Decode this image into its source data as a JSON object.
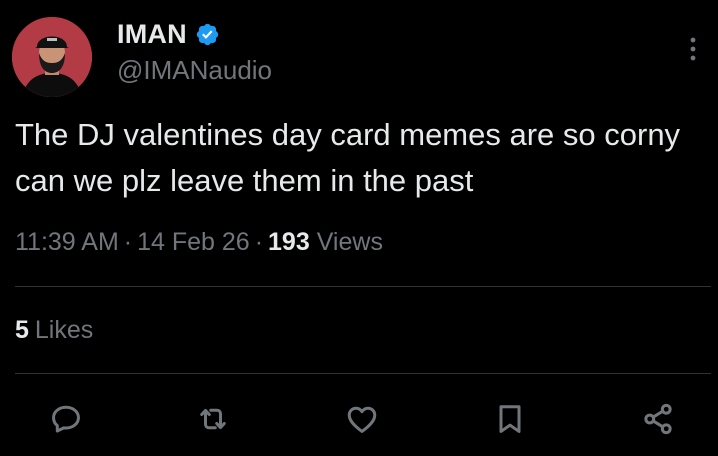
{
  "author": {
    "display_name": "IMAN",
    "handle": "@IMANaudio",
    "verified": true,
    "avatar_icon": "avatar-icon",
    "avatar_bg": "#c7434c"
  },
  "tweet": {
    "text": "The DJ valentines day card memes are so corny can we plz leave them in the past",
    "time": "11:39 AM",
    "date": "14 Feb 26",
    "separator": "·",
    "views_count": "193",
    "views_label": "Views"
  },
  "engagement": {
    "likes_count": "5",
    "likes_label": "Likes"
  },
  "actions": [
    {
      "name": "reply",
      "icon": "speech-bubble-icon"
    },
    {
      "name": "repost",
      "icon": "repost-arrows-icon"
    },
    {
      "name": "like",
      "icon": "heart-icon"
    },
    {
      "name": "bookmark",
      "icon": "bookmark-icon"
    },
    {
      "name": "share",
      "icon": "share-nodes-icon"
    }
  ],
  "colors": {
    "background": "#000000",
    "primary_text": "#e7e9ea",
    "secondary_text": "#71767b",
    "verified_badge": "#1d9bf0",
    "divider": "#2f3336"
  }
}
